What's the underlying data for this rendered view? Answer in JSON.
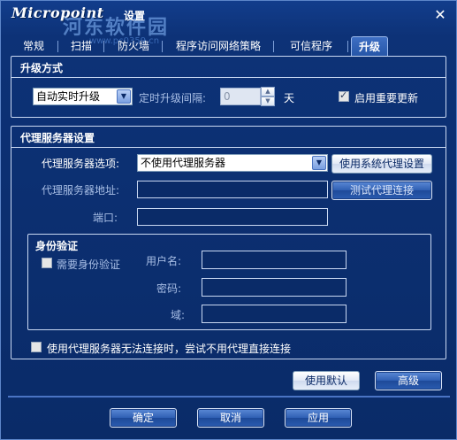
{
  "window": {
    "brand": "Micropoint",
    "title": "设置",
    "watermark": "河东软件园",
    "watermark_url": "www.pc0359.cn",
    "close_glyph": "✕"
  },
  "tabs": [
    {
      "label": "常规",
      "active": false
    },
    {
      "label": "扫描",
      "active": false
    },
    {
      "label": "防火墙",
      "active": false
    },
    {
      "label": "程序访问网络策略",
      "active": false
    },
    {
      "label": "可信程序",
      "active": false
    },
    {
      "label": "升级",
      "active": true
    }
  ],
  "upgrade_mode": {
    "title": "升级方式",
    "mode_value": "自动实时升级",
    "interval_label": "定时升级间隔:",
    "interval_value": "0",
    "interval_unit": "天",
    "important_updates_label": "启用重要更新",
    "important_updates_checked": true
  },
  "proxy": {
    "title": "代理服务器设置",
    "option_label": "代理服务器选项:",
    "option_value": "不使用代理服务器",
    "use_system_button": "使用系统代理设置",
    "address_label": "代理服务器地址:",
    "address_value": "",
    "test_button": "测试代理连接",
    "port_label": "端口:",
    "port_value": "",
    "auth": {
      "title": "身份验证",
      "required_label": "需要身份验证",
      "required_checked": false,
      "username_label": "用户名:",
      "username_value": "",
      "password_label": "密码:",
      "password_value": "",
      "domain_label": "域:",
      "domain_value": ""
    },
    "fallback_label": "使用代理服务器无法连接时，尝试不用代理直接连接",
    "fallback_checked": false
  },
  "actions": {
    "defaults_button": "使用默认",
    "advanced_button": "高级",
    "ok_button": "确定",
    "cancel_button": "取消",
    "apply_button": "应用"
  },
  "icons": {
    "dropdown": "chevron-down-icon",
    "spin_up": "triangle-up-icon",
    "spin_down": "triangle-down-icon",
    "close": "close-icon"
  }
}
